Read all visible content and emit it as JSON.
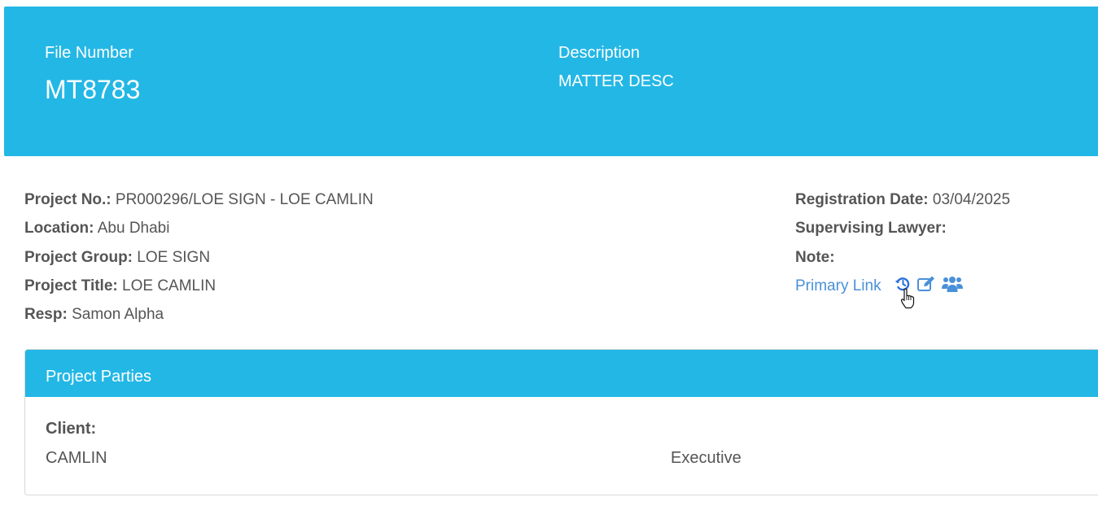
{
  "header": {
    "file_number_label": "File Number",
    "file_number": "MT8783",
    "description_label": "Description",
    "description": "MATTER DESC"
  },
  "details_left": [
    {
      "label": "Project No.:",
      "value": "PR000296/LOE SIGN - LOE CAMLIN"
    },
    {
      "label": "Location:",
      "value": "Abu Dhabi"
    },
    {
      "label": "Project Group:",
      "value": "LOE SIGN"
    },
    {
      "label": "Project Title:",
      "value": "LOE CAMLIN"
    },
    {
      "label": "Resp:",
      "value": "Samon Alpha"
    }
  ],
  "details_right": [
    {
      "label": "Registration Date:",
      "value": "03/04/2025"
    },
    {
      "label": "Supervising Lawyer:",
      "value": ""
    },
    {
      "label": "Note:",
      "value": ""
    }
  ],
  "primary_link": {
    "label": "Primary Link",
    "icons": [
      "history-icon",
      "edit-icon",
      "users-icon"
    ]
  },
  "parties_panel": {
    "title": "Project Parties",
    "client_label": "Client:",
    "client_name": "CAMLIN",
    "client_role": "Executive"
  },
  "colors": {
    "accent": "#23b7e5",
    "link": "#4a90d9",
    "text": "#555555"
  }
}
